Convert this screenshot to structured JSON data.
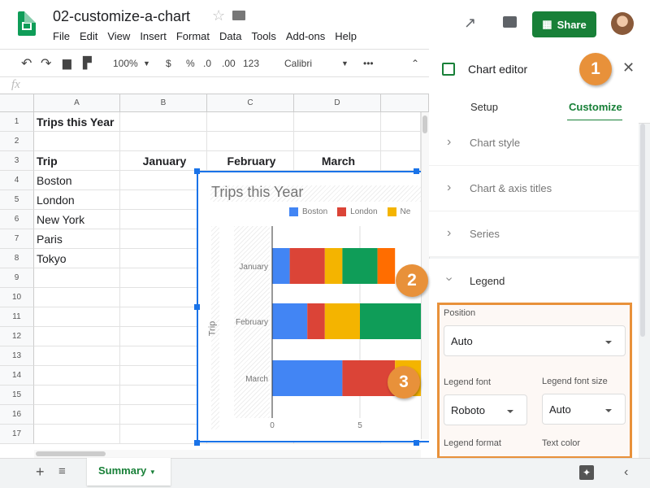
{
  "header": {
    "doc_title": "02-customize-a-chart",
    "menu": [
      "File",
      "Edit",
      "View",
      "Insert",
      "Format",
      "Data",
      "Tools",
      "Add-ons",
      "Help"
    ],
    "share_label": "Share"
  },
  "toolbar": {
    "zoom": "100%",
    "currency": "$",
    "percent": "%",
    "dec_less": ".0",
    "dec_more": ".00",
    "format": "123",
    "font": "Calibri",
    "more": "•••"
  },
  "formula_bar": {
    "fx": "fx"
  },
  "grid": {
    "columns": [
      "A",
      "B",
      "C",
      "D"
    ],
    "rows": [
      "1",
      "2",
      "3",
      "4",
      "5",
      "6",
      "7",
      "8",
      "9",
      "10",
      "11",
      "12",
      "13",
      "14",
      "15",
      "16",
      "17"
    ],
    "cells": {
      "a1": "Trips this Year",
      "a3": "Trip",
      "b3": "January",
      "c3": "February",
      "d3": "March",
      "a4": "Boston",
      "a5": "London",
      "a6": "New York",
      "a7": "Paris",
      "a8": "Tokyo"
    }
  },
  "chart_data": {
    "type": "bar",
    "stacked": true,
    "orientation": "horizontal",
    "title": "Trips this Year",
    "ylabel": "Trip",
    "categories": [
      "January",
      "February",
      "March"
    ],
    "series": [
      {
        "name": "Boston",
        "color": "#4285f4",
        "values": [
          1,
          2,
          4
        ]
      },
      {
        "name": "London",
        "color": "#db4437",
        "values": [
          2,
          1,
          3
        ]
      },
      {
        "name": "New York",
        "color": "#f4b400",
        "values": [
          1,
          2,
          2
        ]
      },
      {
        "name": "Paris",
        "color": "#0f9d58",
        "values": [
          2,
          4,
          null
        ]
      },
      {
        "name": "Tokyo",
        "color": "#ff6d00",
        "values": [
          1,
          null,
          null
        ]
      }
    ],
    "legend_visible": [
      "Boston",
      "London",
      "Ne"
    ],
    "x_ticks": [
      "0",
      "5"
    ],
    "legend": "top"
  },
  "editor": {
    "title": "Chart editor",
    "tabs": [
      "Setup",
      "Customize"
    ],
    "active_tab": "Customize",
    "sections": [
      "Chart style",
      "Chart & axis titles",
      "Series",
      "Legend"
    ],
    "legend": {
      "position_label": "Position",
      "position": "Auto",
      "font_label": "Legend font",
      "font": "Roboto",
      "size_label": "Legend font size",
      "size": "Auto",
      "format_label": "Legend format",
      "color_label": "Text color"
    }
  },
  "callouts": [
    "1",
    "2",
    "3"
  ],
  "sheet_tab": "Summary",
  "colors": {
    "accent": "#188038",
    "highlight": "#e8913a",
    "selection": "#1a73e8"
  }
}
